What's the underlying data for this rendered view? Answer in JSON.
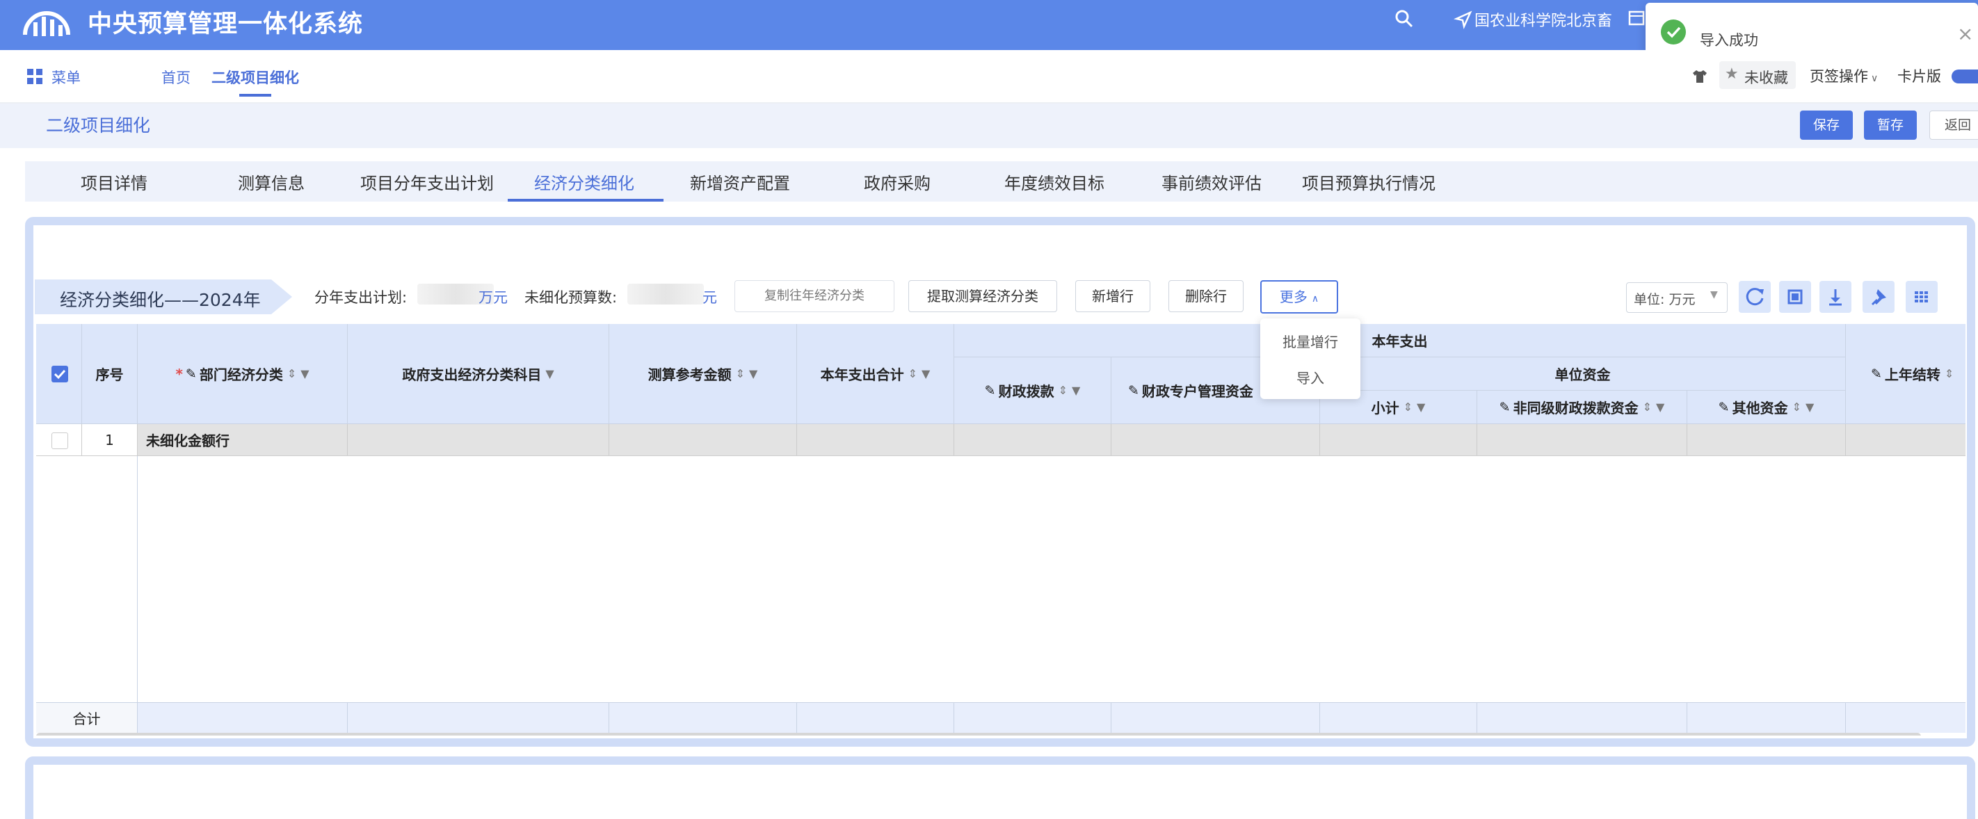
{
  "header": {
    "app_title": "中央预算管理一体化系统",
    "org_name": "国农业科学院北京畜",
    "icons": [
      "logo-icon",
      "search-icon",
      "location-icon",
      "calendar-icon"
    ]
  },
  "toast": {
    "message": "导入成功",
    "status_color": "#53b454",
    "close": "×"
  },
  "nav": {
    "menu_label": "菜单",
    "home": "首页",
    "current": "二级项目细化",
    "favorite": "未收藏",
    "tab_ops": "页签操作",
    "card_mode": "卡片版"
  },
  "page": {
    "title": "二级项目细化",
    "save": "保存",
    "draft": "暂存",
    "back": "返回"
  },
  "tabs": [
    "项目详情",
    "测算信息",
    "项目分年支出计划",
    "经济分类细化",
    "新增资产配置",
    "政府采购",
    "年度绩效目标",
    "事前绩效评估",
    "项目预算执行情况"
  ],
  "active_tab": "经济分类细化",
  "toolbar": {
    "section_title": "经济分类细化——2024年",
    "plan_label": "分年支出计划:",
    "plan_unit": "万元",
    "unfine_label": "未细化预算数:",
    "unfine_unit": "元",
    "copy_prev": "复制往年经济分类",
    "extract": "提取测算经济分类",
    "new_row": "新增行",
    "delete_row": "删除行",
    "more": "更多",
    "unit": "单位: 万元"
  },
  "more_menu": [
    "批量增行",
    "导入"
  ],
  "grid": {
    "headers": {
      "seq": "序号",
      "dept_econ": "部门经济分类",
      "gov_econ": "政府支出经济分类科目",
      "calc_ref": "测算参考金额",
      "year_total": "本年支出合计",
      "year_expense": "本年支出",
      "fiscal": "财政拨款",
      "special": "财政专户管理资金",
      "unit_funds": "单位资金",
      "subtotal": "小计",
      "non_peer": "非同级财政拨款资金",
      "other": "其他资金",
      "last_year": "上年结转"
    },
    "rows": [
      {
        "seq": "1",
        "name": "未细化金额行"
      }
    ],
    "footer": "合计"
  },
  "colors": {
    "brand": "#5b87e8",
    "accent": "#4b74e0",
    "header_bg": "#dce6fa"
  }
}
